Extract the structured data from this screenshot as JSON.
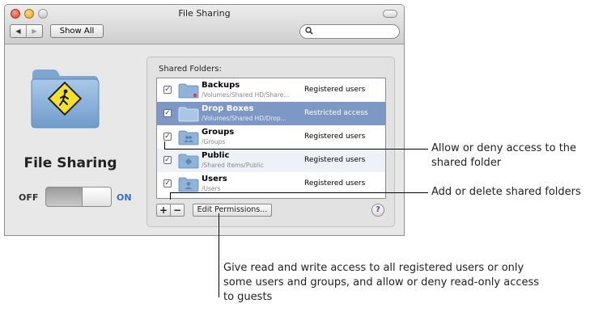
{
  "window": {
    "title": "File Sharing",
    "nav_back": "◀",
    "nav_forward": "▶",
    "show_all_label": "Show All",
    "search_icon_glyph": "⚲",
    "search_placeholder": ""
  },
  "service": {
    "title": "File Sharing",
    "toggle_off_label": "OFF",
    "toggle_on_label": "ON",
    "enabled": true
  },
  "shared_folders": {
    "label": "Shared Folders:",
    "checkbox_glyph": "✓",
    "folders": [
      {
        "name": "Backups",
        "path": "/Volumes/Shared HD/Share...",
        "access": "Registered users",
        "checked": true,
        "selected": false,
        "icon": "folder-icon"
      },
      {
        "name": "Drop Boxes",
        "path": "/Volumes/Shared HD/Drop...",
        "access": "Restricted access",
        "checked": true,
        "selected": true,
        "icon": "folder-icon"
      },
      {
        "name": "Groups",
        "path": "/Groups",
        "access": "Registered users",
        "checked": true,
        "selected": false,
        "icon": "group-folder-icon"
      },
      {
        "name": "Public",
        "path": "/Shared Items/Public",
        "access": "Registered users",
        "checked": true,
        "selected": false,
        "icon": "public-folder-icon"
      },
      {
        "name": "Users",
        "path": "/Users",
        "access": "Registered users",
        "checked": true,
        "selected": false,
        "icon": "users-folder-icon"
      }
    ],
    "add_label": "+",
    "remove_label": "−",
    "edit_permissions_label": "Edit Permissions...",
    "help_label": "?"
  },
  "callouts": {
    "allow_deny": "Allow or deny access to the shared folder",
    "add_delete": "Add or delete shared folders",
    "permissions": "Give read and write access to all registered users or only some users and groups, and allow or deny read-only access to guests"
  },
  "colors": {
    "selection": "#7d98c4",
    "on_label": "#3d6ec0",
    "folder_blue": "#8fb3d9"
  }
}
